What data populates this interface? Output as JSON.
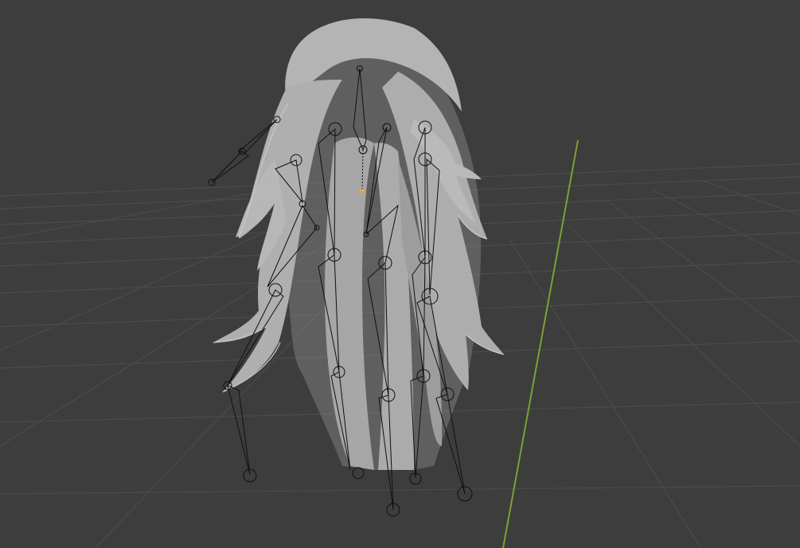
{
  "viewport": {
    "view": "perspective",
    "background_color": "#3d3d3d",
    "grid_color": "#4b4b4b",
    "y_axis_color": "#7aa233",
    "hair_fill_color": "#c9c9c9",
    "hair_edge_color": "#e6e6e6",
    "bone_line_color": "#101010",
    "origin_marker_color": "#f2a43a"
  },
  "scene": {
    "object": "hair-mesh",
    "armature": "hair-bones",
    "bone_chain_count": 6
  }
}
